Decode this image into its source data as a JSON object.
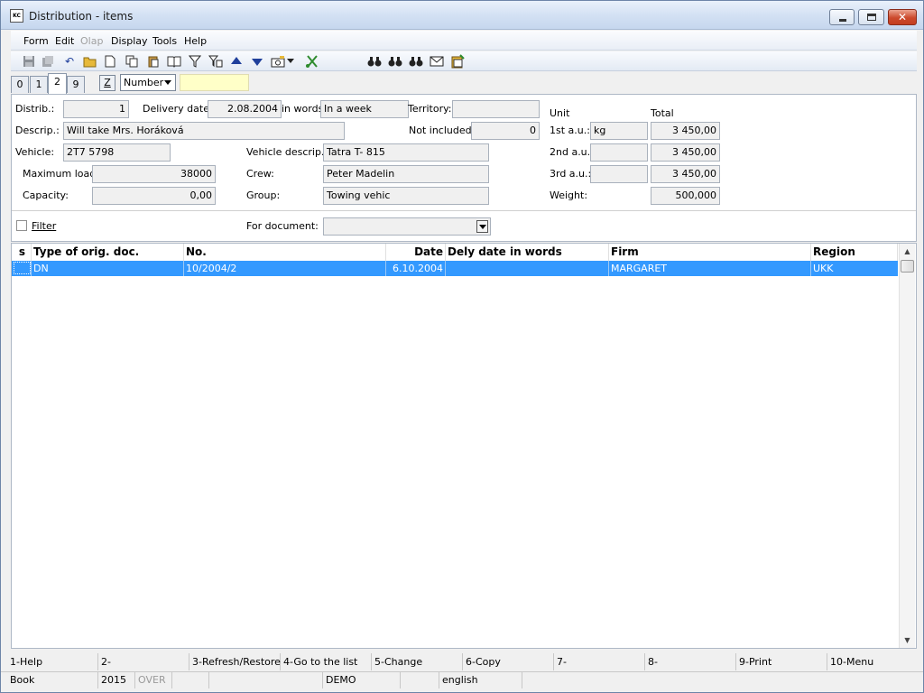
{
  "window": {
    "title": "Distribution - items",
    "app_icon_text": "KC"
  },
  "menu": [
    {
      "label": "Form",
      "enabled": true
    },
    {
      "label": "Edit",
      "enabled": true
    },
    {
      "label": "Olap",
      "enabled": false
    },
    {
      "label": "Display",
      "enabled": true
    },
    {
      "label": "Tools",
      "enabled": true
    },
    {
      "label": "Help",
      "enabled": true
    }
  ],
  "toolbar": {
    "icons": [
      "save-icon",
      "save-all-icon",
      "undo-icon",
      "open-icon",
      "new-icon",
      "copy-icon",
      "paste-icon",
      "book-icon",
      "filter-icon",
      "filter-list-icon",
      "arrow-up-icon",
      "arrow-down-icon",
      "camera-icon",
      "dropdown-arrow-icon",
      "cut-icon",
      "binoculars-icon",
      "binoculars-next-icon",
      "binoculars-prev-icon",
      "mail-icon",
      "clipboard-icon"
    ],
    "accent_up_down": "#1f3f9b"
  },
  "tabs": [
    {
      "label": "0",
      "active": false
    },
    {
      "label": "1",
      "active": false
    },
    {
      "label": "2",
      "active": true
    },
    {
      "label": "9",
      "active": false
    }
  ],
  "sort": {
    "button": "Z",
    "selected": "Number",
    "search_value": ""
  },
  "form": {
    "distrib_label": "Distrib.:",
    "distrib": "1",
    "delivery_date_label": "Delivery date:",
    "delivery_date": "2.08.2004",
    "in_words_label": "in words",
    "in_words": "In a week",
    "territory_label": "Territory:",
    "territory": "",
    "descrip_label": "Descrip.:",
    "descrip": "Will take Mrs. Horáková",
    "not_included_label": "Not included:",
    "not_included": "0",
    "vehicle_label": "Vehicle:",
    "vehicle": "2T7 5798",
    "vehicle_descrip_label": "Vehicle descrip.:",
    "vehicle_descrip": "Tatra T- 815",
    "max_load_label": "Maximum load:",
    "max_load": "38000",
    "crew_label": "Crew:",
    "crew": "Peter Madelin",
    "capacity_label": "Capacity:",
    "capacity": "0,00",
    "group_label": "Group:",
    "group": "Towing vehic",
    "unit_header": "Unit",
    "total_header": "Total",
    "au1_label": "1st a.u.:",
    "au1_unit": "kg",
    "au1_total": "3 450,00",
    "au2_label": "2nd a.u.:",
    "au2_unit": "",
    "au2_total": "3 450,00",
    "au3_label": "3rd a.u.:",
    "au3_unit": "",
    "au3_total": "3 450,00",
    "weight_label": "Weight:",
    "weight": "500,000",
    "filter_label": "Filter",
    "filter_checked": false,
    "for_document_label": "For document:",
    "for_document": ""
  },
  "grid": {
    "columns": [
      "s",
      "Type of orig. doc.",
      "No.",
      "Date",
      "Dely date in words",
      "Firm",
      "Region"
    ],
    "rows": [
      {
        "s": "",
        "type": "DN",
        "no": "10/2004/2",
        "date": "6.10.2004",
        "words": "",
        "firm": "MARGARET",
        "region": "UKK",
        "selected": true
      }
    ],
    "selection_color": "#3399ff"
  },
  "function_keys": [
    "1-Help",
    "2-",
    "3-Refresh/Restore",
    "4-Go to the list",
    "5-Change",
    "6-Copy",
    "7-",
    "8-",
    "9-Print",
    "10-Menu"
  ],
  "status": {
    "module": "Book",
    "year": "2015",
    "mode": "OVER",
    "empty1": "",
    "empty2": "",
    "database": "DEMO",
    "empty3": "",
    "language": "english"
  }
}
